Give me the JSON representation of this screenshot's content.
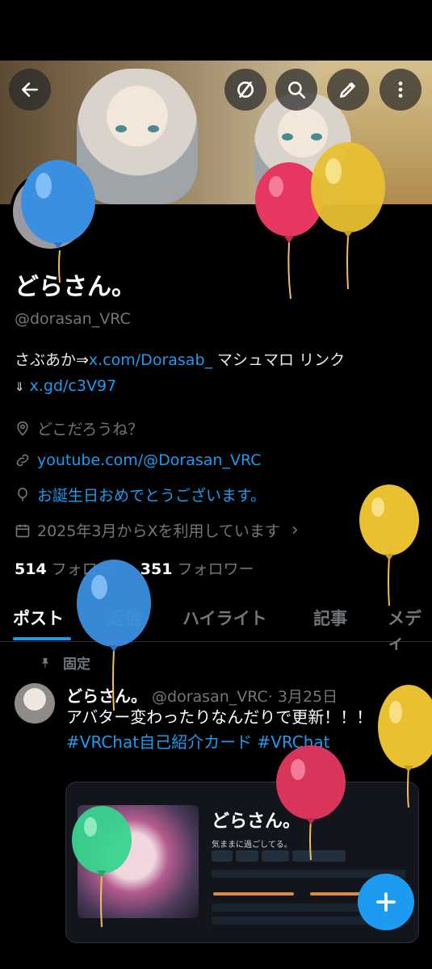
{
  "profile": {
    "name": "どらさん。",
    "handle": "@dorasan_VRC",
    "bio_text": "さぶあか⇒",
    "bio_link1": "x.com/Dorasab_",
    "bio_text2": " マシュマロ リンク",
    "bio_arrow": "⇓",
    "bio_link2": "x.gd/c3V97",
    "location": "どこだろうね？",
    "website": "youtube.com/@Dorasan_VRC",
    "birthday": "お誕生日おめでとうございます。",
    "joined": "2025年3月からXを利用しています",
    "following_count": "514",
    "following_label": "フォロー",
    "followers_count": "351",
    "followers_label": "フォロワー"
  },
  "tabs": [
    {
      "label": "ポスト"
    },
    {
      "label": "返信"
    },
    {
      "label": "ハイライト"
    },
    {
      "label": "記事"
    },
    {
      "label": "メディ"
    }
  ],
  "pinned_post": {
    "pinned_label": "固定",
    "author": "どらさん。",
    "handle": "@dorasan_VRC",
    "date": "· 3月25日",
    "text": "アバター変わったりなんだりで更新！！！",
    "hashtags": "#VRChat自己紹介カード #VRChat",
    "card_title": "どらさん。",
    "card_subtitle": "気ままに過ごしてる。"
  },
  "icons": {
    "back": "back-arrow-icon",
    "hide": "eye-slash-icon",
    "search": "search-icon",
    "edit": "edit-icon",
    "more": "more-vertical-icon",
    "compose": "plus-icon"
  },
  "colors": {
    "accent": "#1d9bf0",
    "background": "#000000",
    "muted": "#71767b"
  }
}
